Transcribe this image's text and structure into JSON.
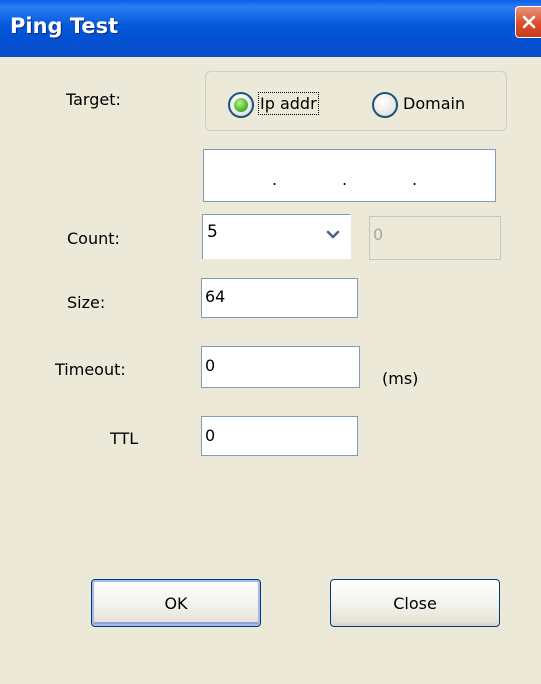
{
  "window": {
    "title": "Ping Test"
  },
  "target": {
    "label": "Target:",
    "options": [
      {
        "label": "Ip addr",
        "selected": true
      },
      {
        "label": "Domain",
        "selected": false
      }
    ],
    "ip_dots": [
      ".",
      ".",
      "."
    ]
  },
  "count": {
    "label": "Count:",
    "value": "5",
    "extra_value": "0"
  },
  "size": {
    "label": "Size:",
    "value": "64"
  },
  "timeout": {
    "label": "Timeout:",
    "value": "0",
    "unit": "(ms)"
  },
  "ttl": {
    "label": "TTL",
    "value": "0"
  },
  "buttons": {
    "ok": "OK",
    "close": "Close"
  },
  "colors": {
    "titlebar": "#0458d9",
    "dialog_bg": "#ece9d8",
    "close_red": "#d94f2c"
  }
}
